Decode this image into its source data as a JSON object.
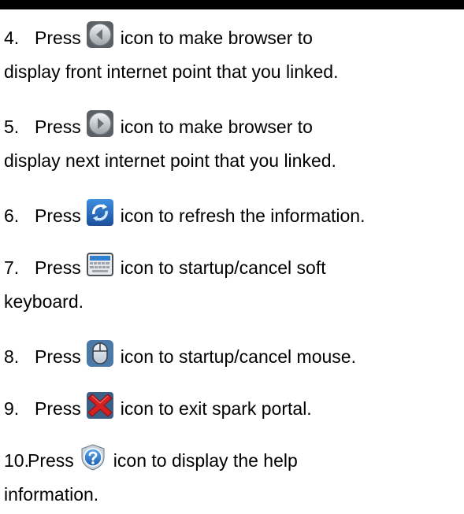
{
  "items": [
    {
      "num": "4.",
      "press": "Press",
      "icon": "back-icon",
      "text": "icon to make browser to",
      "cont": "display front internet point that you linked."
    },
    {
      "num": "5.",
      "press": "Press",
      "icon": "forward-icon",
      "text": "icon to make browser to",
      "cont": "display next internet point that you linked."
    },
    {
      "num": "6.",
      "press": "Press",
      "icon": "refresh-icon",
      "text": "icon to refresh the information."
    },
    {
      "num": "7.",
      "press": "Press",
      "icon": "keyboard-icon",
      "text": "icon to startup/cancel soft",
      "cont": "keyboard."
    },
    {
      "num": "8.",
      "press": "Press",
      "icon": "mouse-icon",
      "text": "icon to startup/cancel mouse."
    },
    {
      "num": "9.",
      "press": "Press",
      "icon": "exit-icon",
      "text": "icon to exit spark portal."
    },
    {
      "num": "10.",
      "press": "Press",
      "icon": "help-icon",
      "text": "icon to display the help",
      "cont": "information."
    }
  ],
  "colors": {
    "accent_blue": "#2f7fd0",
    "exit_red": "#d42020",
    "icon_gray": "#8a8e94"
  }
}
